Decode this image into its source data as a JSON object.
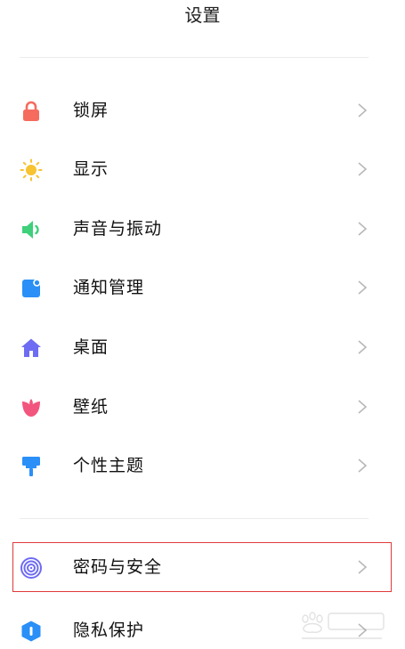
{
  "header": {
    "title": "设置"
  },
  "colors": {
    "highlight_border": "#e03a3a",
    "lock": "#f56c5e",
    "display": "#f7c331",
    "sound": "#3ed07a",
    "notification": "#2a8ff7",
    "desktop": "#6e6cf2",
    "wallpaper": "#f2557d",
    "theme": "#2a8ff7",
    "security": "#6e6cf2",
    "privacy": "#2a8ff7"
  },
  "settings": {
    "items": [
      {
        "label": "锁屏",
        "icon": "lock-icon"
      },
      {
        "label": "显示",
        "icon": "sun-icon"
      },
      {
        "label": "声音与振动",
        "icon": "speaker-icon"
      },
      {
        "label": "通知管理",
        "icon": "notification-icon"
      },
      {
        "label": "桌面",
        "icon": "home-icon"
      },
      {
        "label": "壁纸",
        "icon": "tulip-icon"
      },
      {
        "label": "个性主题",
        "icon": "paint-roller-icon"
      },
      {
        "label": "密码与安全",
        "icon": "fingerprint-icon",
        "highlighted": true
      },
      {
        "label": "隐私保护",
        "icon": "shield-icon"
      }
    ]
  }
}
